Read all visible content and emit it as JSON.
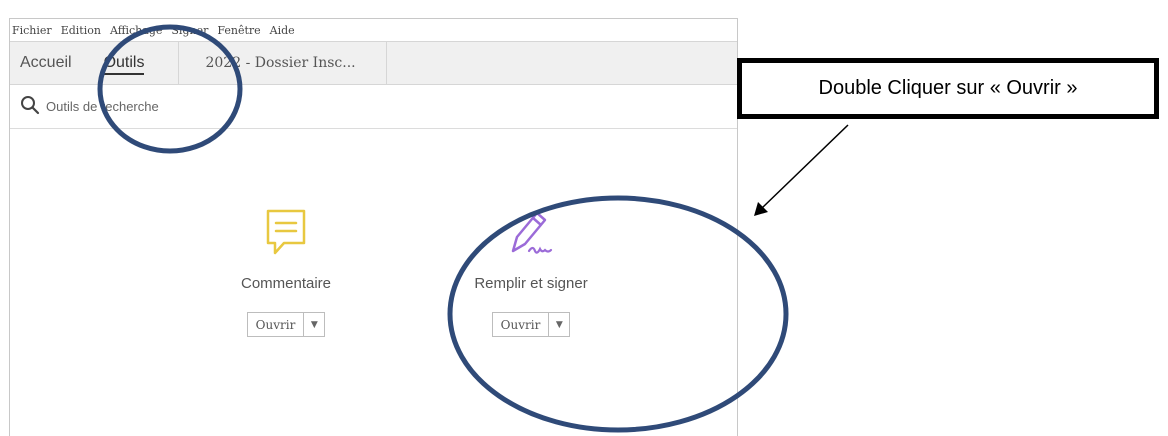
{
  "menu": [
    "Fichier",
    "Edition",
    "Affichage",
    "Signer",
    "Fenêtre",
    "Aide"
  ],
  "tabs": {
    "home": "Accueil",
    "tools": "Outils",
    "document": "2022 - Dossier Insc..."
  },
  "search": {
    "placeholder": "Outils de recherche"
  },
  "tools": [
    {
      "label": "Commentaire",
      "open": "Ouvrir",
      "icon": "comment-icon",
      "color": "#e8c840"
    },
    {
      "label": "Remplir et signer",
      "open": "Ouvrir",
      "icon": "fill-sign-icon",
      "color": "#9b6bd8"
    }
  ],
  "annotation": {
    "text": "Double Cliquer sur « Ouvrir »",
    "circle_color": "#2f4a78"
  }
}
